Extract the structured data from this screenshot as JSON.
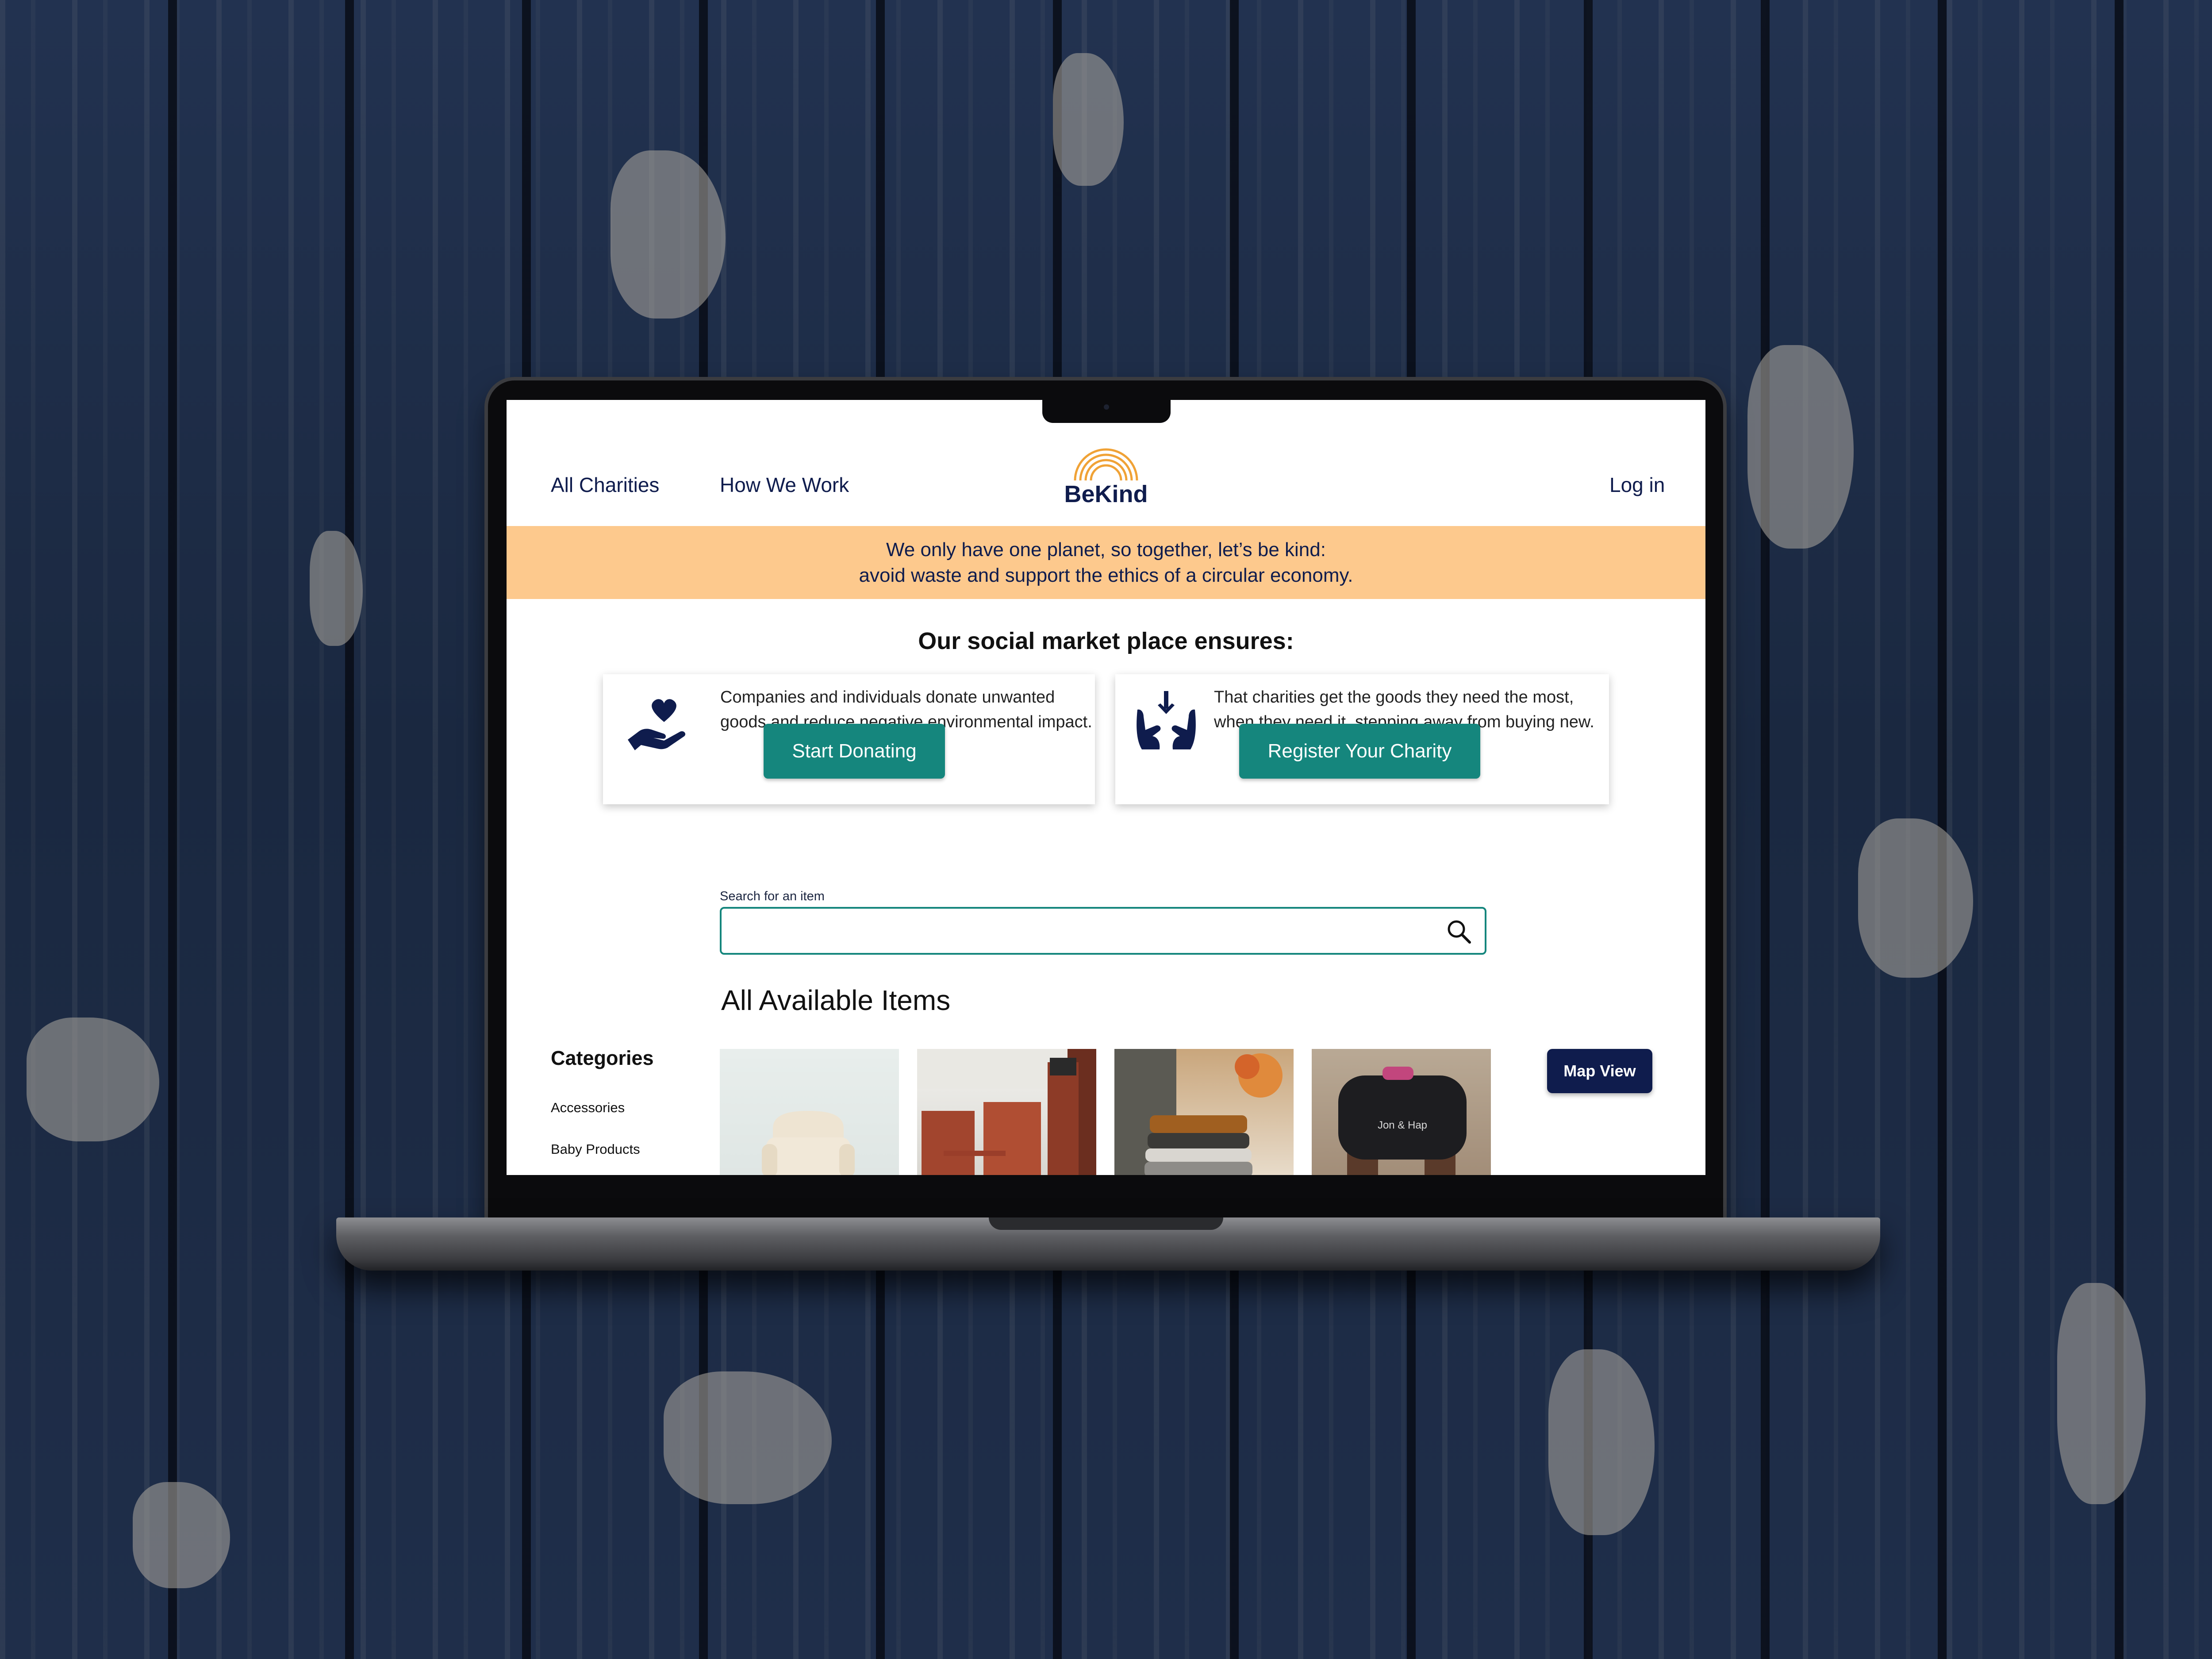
{
  "nav": {
    "all_charities": "All Charities",
    "how_we_work": "How We Work",
    "logo_text": "BeKind",
    "login": "Log in"
  },
  "banner": {
    "line1": "We only have one planet, so together, let’s be kind:",
    "line2": "avoid waste and support the ethics of a circular economy."
  },
  "ensures": {
    "title": "Our social market place ensures:",
    "donor_card": {
      "icon": "heart-in-hand-icon",
      "text_line1": "Companies and individuals donate unwanted",
      "text_line2": "goods and reduce negative environmental impact.",
      "button": "Start Donating"
    },
    "charity_card": {
      "icon": "hands-receiving-icon",
      "text_line1": "That charities get the goods they need the most,",
      "text_line2": "when they need it, stepping away from buying new.",
      "button": "Register Your Charity"
    }
  },
  "search": {
    "label": "Search for an item",
    "value": "",
    "icon": "search-icon"
  },
  "items": {
    "title": "All Available Items",
    "map_view": "Map View",
    "thumbnails": [
      "armchair",
      "wooden-chairs-and-cabinet",
      "folded-knit-blankets",
      "held-bag-jon-and-hap"
    ],
    "bag_brand": "Jon & Hap"
  },
  "categories": {
    "title": "Categories",
    "items": [
      "Accessories",
      "Baby Products"
    ]
  },
  "colors": {
    "navy": "#0f1c4d",
    "teal": "#15867d",
    "banner": "#fdc98d",
    "logo_orange": "#f0a236"
  }
}
